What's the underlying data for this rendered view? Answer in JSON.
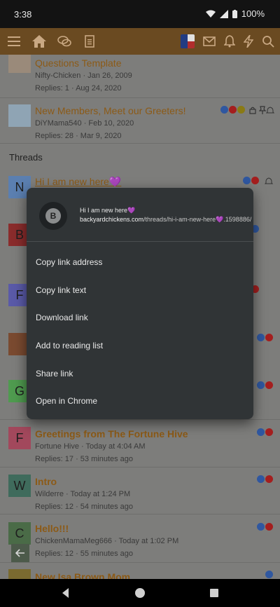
{
  "status": {
    "time": "3:38",
    "battery": "100%"
  },
  "colors": {
    "nav": "#6a4a21",
    "menu_bg": "#303436",
    "title": "#8c5a16"
  },
  "top_list": [
    {
      "title": "Questions Template",
      "author_date": "Nifty-Chicken · Jan 26, 2009",
      "stats": "Replies: 1 · Aug 24, 2020"
    },
    {
      "title": "New Members, Meet our Greeters!",
      "author_date": "DiYMama540 · Feb 10, 2020",
      "stats": "Replies: 28 · Mar 9, 2020"
    }
  ],
  "section": {
    "label": "Threads"
  },
  "threads": [
    {
      "avatar": "N",
      "title": "Hi I am new here💜"
    },
    {
      "avatar": "B"
    },
    {
      "avatar": "F"
    },
    {
      "avatar": ""
    },
    {
      "avatar": "G"
    },
    {
      "avatar": "F",
      "title": "Greetings from The Fortune Hive",
      "meta": "Fortune Hive · Today at 4:04 AM",
      "stats": "Replies: 17 · 53 minutes ago"
    },
    {
      "avatar": "W",
      "title": "Intro",
      "meta": "Wilderre · Today at 1:24 PM",
      "stats": "Replies: 12 · 54 minutes ago"
    },
    {
      "avatar": "C",
      "title": "Hello!!!",
      "meta": "ChickenMamaMeg666 · Today at 1:02 PM",
      "stats": "Replies: 12 · 55 minutes ago"
    },
    {
      "title": "New Isa Brown Mom"
    }
  ],
  "context_menu": {
    "favicon_letter": "B",
    "link_title": "Hi I am new here💜",
    "link_domain": "backyardchickens.com",
    "link_path": "/threads/hi-i-am-new-here💜.1598886/",
    "options": [
      "Copy link address",
      "Copy link text",
      "Download link",
      "Add to reading list",
      "Share link",
      "Open in Chrome"
    ]
  },
  "icons": [
    "menu-icon",
    "home-icon",
    "chat-icon",
    "document-icon",
    "mail-icon",
    "bell-icon",
    "lightning-icon",
    "search-icon"
  ]
}
